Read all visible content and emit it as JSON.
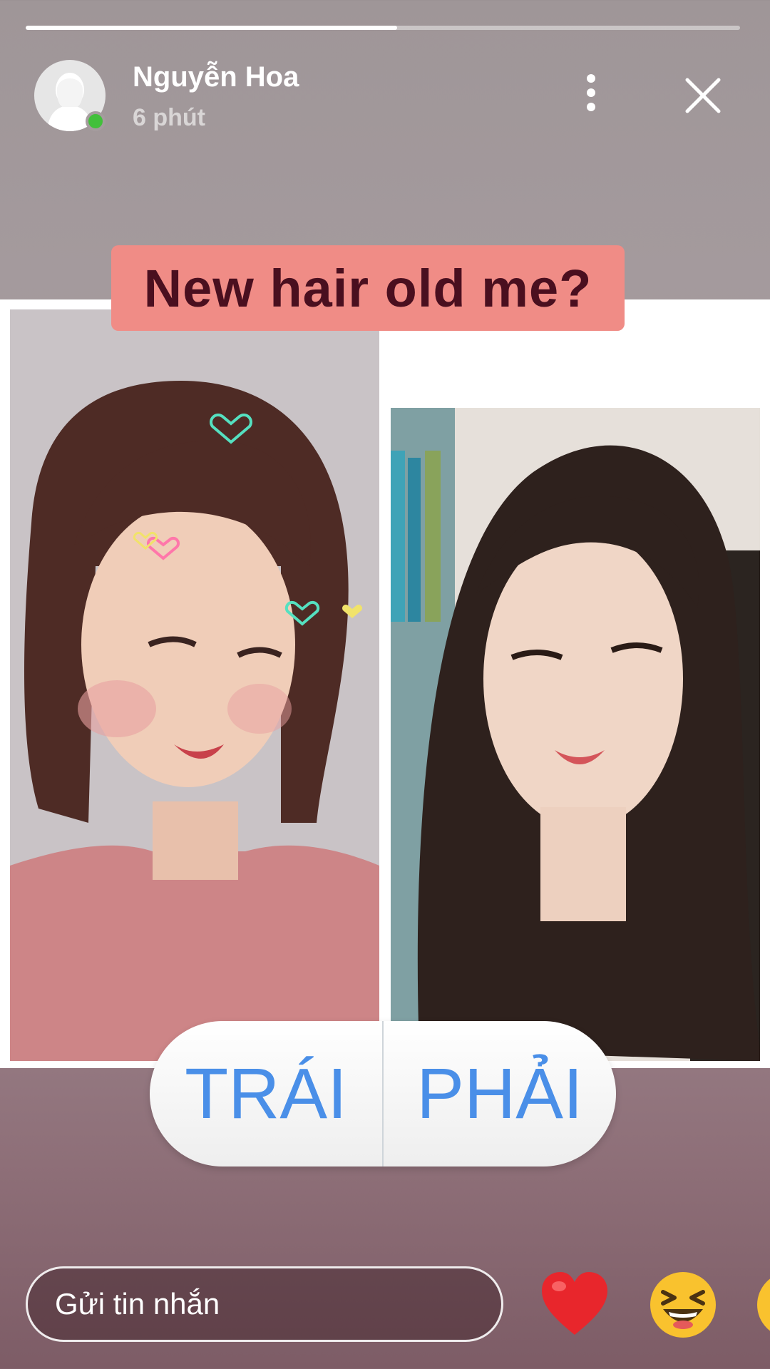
{
  "story": {
    "progress": 0.52,
    "user_name": "Nguyễn Hoa",
    "time_ago": "6 phút",
    "caption": "New hair old me?"
  },
  "poll": {
    "option_left": "TRÁI",
    "option_right": "PHẢI"
  },
  "reply": {
    "placeholder": "Gửi tin nhắn"
  },
  "icons": {
    "more": "more-vertical-icon",
    "close": "close-icon",
    "reactions": [
      "heart-emoji",
      "laughing-emoji",
      "emoji-partial"
    ]
  },
  "colors": {
    "caption_bg": "#f08c86",
    "caption_text": "#4a0f1f",
    "poll_text": "#4a8fe8",
    "online": "#42c03b"
  }
}
